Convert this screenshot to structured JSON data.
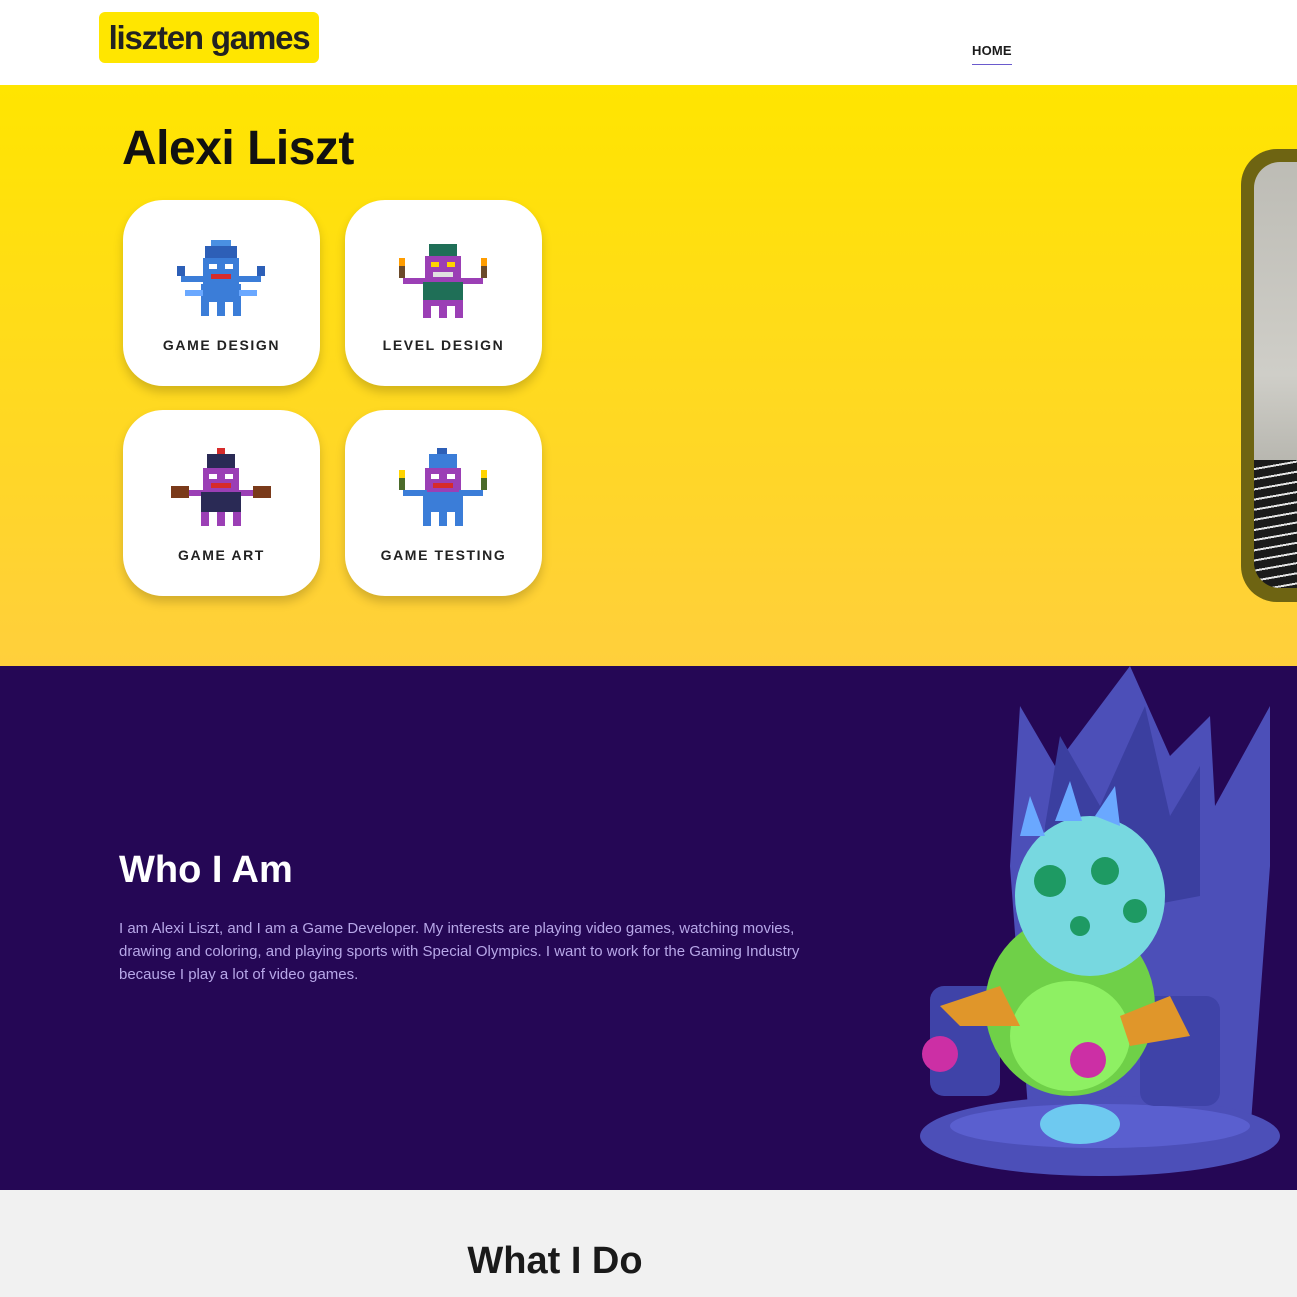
{
  "header": {
    "logo_text": "liszten games",
    "nav": [
      {
        "label": "HOME",
        "active": true
      }
    ]
  },
  "hero": {
    "title": "Alexi Liszt",
    "skills": [
      {
        "label": "GAME DESIGN",
        "icon": "blue-octopus-monster-icon"
      },
      {
        "label": "LEVEL DESIGN",
        "icon": "purple-torch-monster-icon"
      },
      {
        "label": "GAME ART",
        "icon": "dark-horned-monster-icon"
      },
      {
        "label": "GAME TESTING",
        "icon": "blue-torch-monster-icon"
      }
    ],
    "photo": "profile-photo"
  },
  "about": {
    "title": "Who I Am",
    "text": "I am Alexi Liszt, and I am a Game Developer. My interests are playing video games, watching movies, drawing and coloring, and playing sports with Special Olympics. I want to work for the Gaming Industry because I play a lot of video games.",
    "art": "monster-on-throne-illustration"
  },
  "whatido": {
    "title": "What I Do"
  },
  "colors": {
    "brand_yellow": "#ffe600",
    "hero_gradient_top": "#ffe500",
    "hero_gradient_bottom": "#ffcf3c",
    "about_bg": "#250755",
    "about_text": "#b7a7e8",
    "nav_underline": "#6a5acd"
  }
}
